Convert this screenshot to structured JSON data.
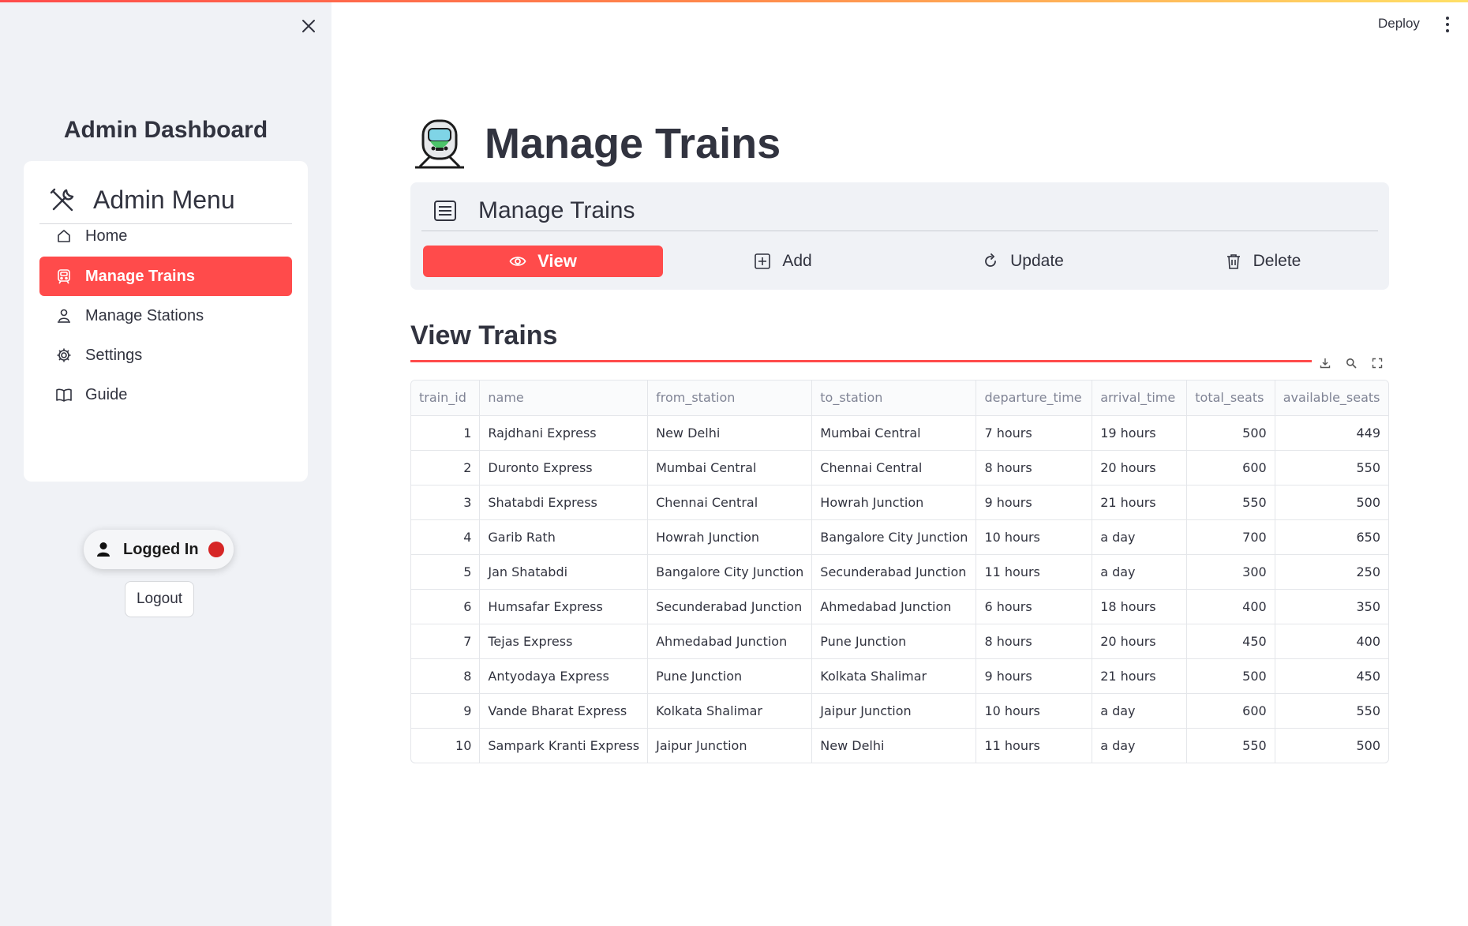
{
  "sidebar": {
    "title": "Admin Dashboard",
    "menu_title": "Admin Menu",
    "items": [
      {
        "label": "Home",
        "icon": "home-icon"
      },
      {
        "label": "Manage Trains",
        "icon": "train-icon"
      },
      {
        "label": "Manage Stations",
        "icon": "person-pin-icon"
      },
      {
        "label": "Settings",
        "icon": "gear-icon"
      },
      {
        "label": "Guide",
        "icon": "book-icon"
      }
    ],
    "status": "Logged In",
    "logout_label": "Logout"
  },
  "header": {
    "deploy_label": "Deploy"
  },
  "main": {
    "title": "Manage Trains",
    "card_title": "Manage Trains",
    "tabs": [
      {
        "label": "View",
        "icon": "eye-icon"
      },
      {
        "label": "Add",
        "icon": "plus-square-icon"
      },
      {
        "label": "Update",
        "icon": "refresh-icon"
      },
      {
        "label": "Delete",
        "icon": "trash-icon"
      }
    ],
    "section_title": "View Trains",
    "table": {
      "columns": [
        "train_id",
        "name",
        "from_station",
        "to_station",
        "departure_time",
        "arrival_time",
        "total_seats",
        "available_seats"
      ],
      "rows": [
        [
          "1",
          "Rajdhani Express",
          "New Delhi",
          "Mumbai Central",
          "7 hours",
          "19 hours",
          "500",
          "449"
        ],
        [
          "2",
          "Duronto Express",
          "Mumbai Central",
          "Chennai Central",
          "8 hours",
          "20 hours",
          "600",
          "550"
        ],
        [
          "3",
          "Shatabdi Express",
          "Chennai Central",
          "Howrah Junction",
          "9 hours",
          "21 hours",
          "550",
          "500"
        ],
        [
          "4",
          "Garib Rath",
          "Howrah Junction",
          "Bangalore City Junction",
          "10 hours",
          "a day",
          "700",
          "650"
        ],
        [
          "5",
          "Jan Shatabdi",
          "Bangalore City Junction",
          "Secunderabad Junction",
          "11 hours",
          "a day",
          "300",
          "250"
        ],
        [
          "6",
          "Humsafar Express",
          "Secunderabad Junction",
          "Ahmedabad Junction",
          "6 hours",
          "18 hours",
          "400",
          "350"
        ],
        [
          "7",
          "Tejas Express",
          "Ahmedabad Junction",
          "Pune Junction",
          "8 hours",
          "20 hours",
          "450",
          "400"
        ],
        [
          "8",
          "Antyodaya Express",
          "Pune Junction",
          "Kolkata Shalimar",
          "9 hours",
          "21 hours",
          "500",
          "450"
        ],
        [
          "9",
          "Vande Bharat Express",
          "Kolkata Shalimar",
          "Jaipur Junction",
          "10 hours",
          "a day",
          "600",
          "550"
        ],
        [
          "10",
          "Sampark Kranti Express",
          "Jaipur Junction",
          "New Delhi",
          "11 hours",
          "a day",
          "550",
          "500"
        ]
      ]
    }
  },
  "colors": {
    "accent": "#ff4b4b",
    "sidebar_bg": "#f0f2f6",
    "status_dot": "#d62626"
  }
}
